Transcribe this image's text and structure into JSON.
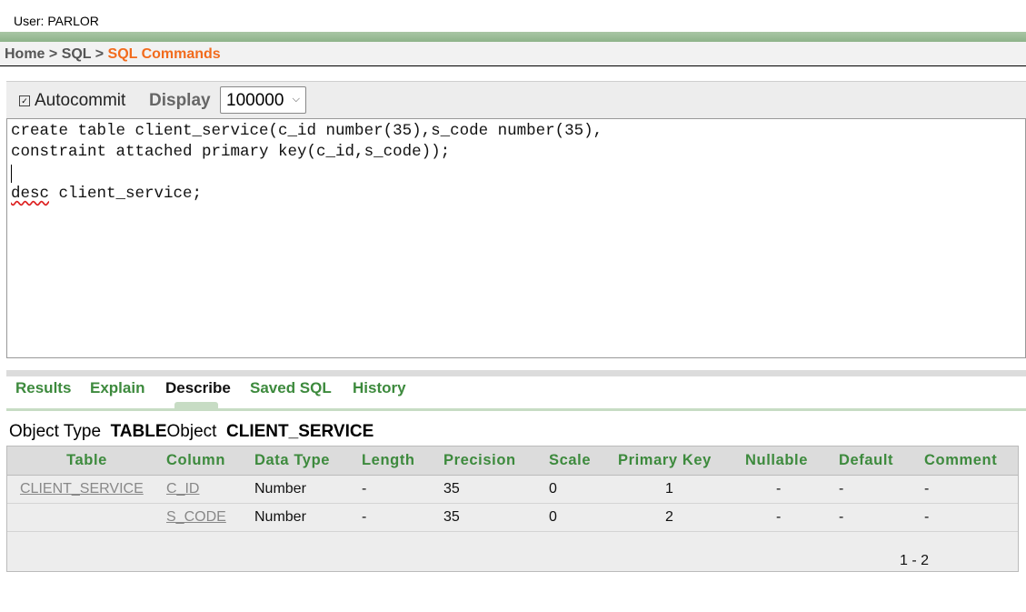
{
  "user": "User: PARLOR",
  "breadcrumb": {
    "home": "Home",
    "sep1": " > ",
    "sql": "SQL",
    "sep2": " > ",
    "current": "SQL Commands"
  },
  "toolbar": {
    "autocommit_label": "Autocommit",
    "autocommit_checked": true,
    "display_label": "Display",
    "display_value": "100000"
  },
  "editor": {
    "lines": [
      "create table client_service(c_id number(35),s_code number(35),",
      "constraint attached primary key(c_id,s_code));",
      "",
      "desc client_service;"
    ],
    "line4_keyword": "desc",
    "line4_rest": " client_service;"
  },
  "tabs": [
    "Results",
    "Explain",
    "Describe",
    "Saved SQL",
    "History"
  ],
  "active_tab": "Describe",
  "object_info": {
    "type_label": "Object Type",
    "type_value": "TABLE",
    "object_label": "Object",
    "object_value": "CLIENT_SERVICE"
  },
  "table": {
    "headers": [
      "Table",
      "Column",
      "Data Type",
      "Length",
      "Precision",
      "Scale",
      "Primary Key",
      "Nullable",
      "Default",
      "Comment"
    ],
    "rows": [
      [
        "CLIENT_SERVICE",
        "C_ID",
        "Number",
        "-",
        "35",
        "0",
        "1",
        "-",
        "-",
        "-"
      ],
      [
        "",
        "S_CODE",
        "Number",
        "-",
        "35",
        "0",
        "2",
        "-",
        "-",
        "-"
      ]
    ]
  },
  "pagination": "1 - 2",
  "colors": {
    "accent_green": "#3d8a3d",
    "breadcrumb_current": "#f26b1d"
  }
}
